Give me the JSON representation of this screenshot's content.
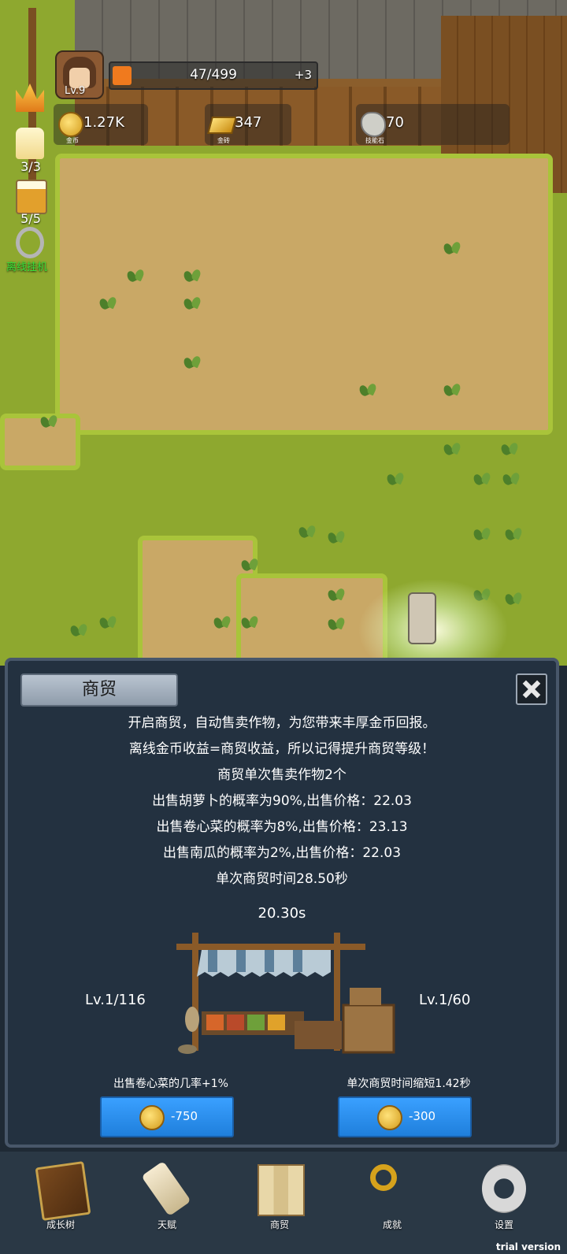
{
  "hud": {
    "level": "Lv.9",
    "xp_text": "47/499",
    "xp_fraction": 0.094,
    "xp_bonus": "+3",
    "resources": [
      {
        "value": "1.27K",
        "caption": "金币",
        "icon": "gold-coin-icon"
      },
      {
        "value": "347",
        "caption": "金砖",
        "icon": "gold-ingot-icon"
      },
      {
        "value": "70",
        "caption": "技能石",
        "icon": "skill-stone-icon"
      }
    ],
    "side": {
      "candle": "3/3",
      "beer": "5/5",
      "idle": "离线挂机"
    }
  },
  "panel": {
    "tab": "商贸",
    "lines": [
      "开启商贸，自动售卖作物，为您带来丰厚金币回报。",
      "离线金币收益=商贸收益，所以记得提升商贸等级！",
      "商贸单次售卖作物2个",
      "出售胡萝卜的概率为90%,出售价格：22.03",
      "出售卷心菜的概率为8%,出售价格：23.13",
      "出售南瓜的概率为2%,出售价格：22.03",
      "单次商贸时间28.50秒"
    ],
    "timer": "20.30s",
    "left_level": "Lv.1/116",
    "right_level": "Lv.1/60",
    "left_upgrade_label": "出售卷心菜的几率+1%",
    "right_upgrade_label": "单次商贸时间缩短1.42秒",
    "left_cost": "-750",
    "right_cost": "-300"
  },
  "nav": [
    {
      "label": "成长树",
      "icon": "book-icon"
    },
    {
      "label": "天赋",
      "icon": "scroll-icon"
    },
    {
      "label": "商贸",
      "icon": "map-icon"
    },
    {
      "label": "成就",
      "icon": "key-icon"
    },
    {
      "label": "设置",
      "icon": "gear-icon"
    }
  ],
  "watermark": "trial version"
}
